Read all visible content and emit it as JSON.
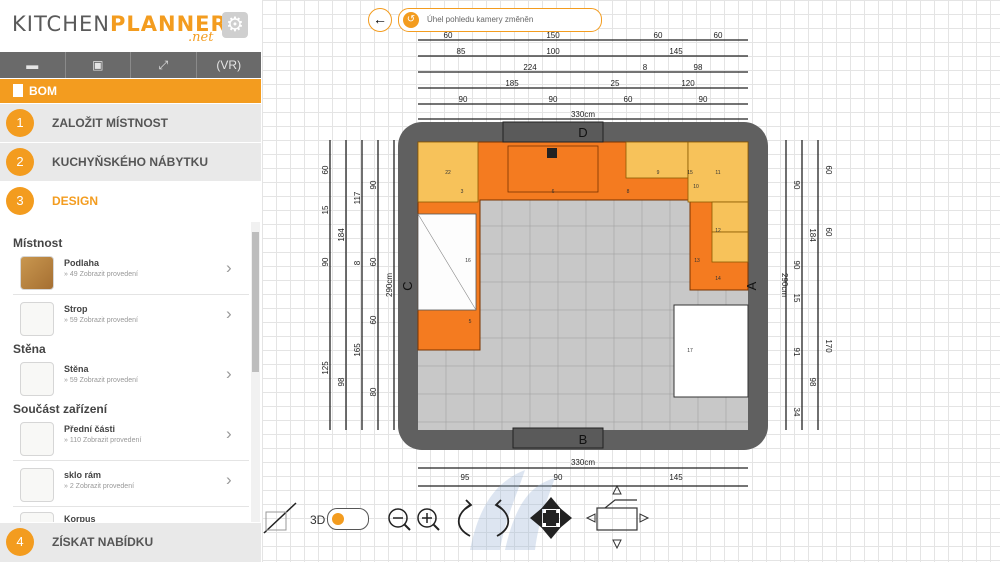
{
  "logo": {
    "brand_part1": "KITCHEN",
    "brand_part2": "PLANNER",
    "sub": ".net"
  },
  "toolbar": {
    "icons": [
      "folder-icon",
      "save-icon",
      "fullscreen-icon",
      "vr-icon"
    ],
    "vr_label": "VR"
  },
  "bom": {
    "label": "BOM"
  },
  "steps": [
    {
      "num": "1",
      "label": "ZALOŽIT MÍSTNOST"
    },
    {
      "num": "2",
      "label": "KUCHYŇSKÉHO NÁBYTKU"
    },
    {
      "num": "3",
      "label": "DESIGN"
    },
    {
      "num": "4",
      "label": "ZÍSKAT NABÍDKU"
    }
  ],
  "sections": {
    "room": "Místnost",
    "wall": "Stěna",
    "equipment": "Součást zařízení"
  },
  "items": [
    {
      "title": "Podlaha",
      "sub": "» 49 Zobrazit provedení"
    },
    {
      "title": "Strop",
      "sub": "» 59 Zobrazit provedení"
    },
    {
      "title": "Stěna",
      "sub": "» 59 Zobrazit provedení"
    },
    {
      "title": "Přední části",
      "sub": "» 110 Zobrazit provedení"
    },
    {
      "title": "sklo rám",
      "sub": "» 2 Zobrazit provedení"
    },
    {
      "title": "Korpus",
      "sub": ""
    }
  ],
  "status": {
    "message": "Úhel pohledu kamery změněn"
  },
  "toggle": {
    "label": "3D"
  },
  "plan": {
    "top_dims": [
      [
        "60",
        "150",
        "60",
        "60"
      ],
      [
        "85",
        "100",
        "145"
      ],
      [
        "224",
        "8",
        "98"
      ],
      [
        "185",
        "25",
        "120"
      ],
      [
        "90",
        "90",
        "60",
        "90"
      ]
    ],
    "total_top": "330cm",
    "total_bottom": "330cm",
    "bottom_dims": [
      "95",
      "90",
      "145"
    ],
    "left_dims": [
      "60",
      "15",
      "184",
      "117",
      "90",
      "8",
      "60",
      "90",
      "60",
      "125",
      "165",
      "98",
      "80"
    ],
    "right_dims": [
      "60",
      "90",
      "184",
      "60",
      "90",
      "15",
      "91",
      "170",
      "98",
      "34"
    ],
    "height_label": "290cm",
    "walls": {
      "top": "D",
      "bottom": "B",
      "left": "C",
      "right": "A"
    },
    "cabinet_numbers": [
      "22",
      "3",
      "6",
      "8",
      "9",
      "15",
      "10",
      "11",
      "12",
      "13",
      "14",
      "16",
      "5",
      "17"
    ]
  },
  "colors": {
    "accent": "#f39c1f",
    "cabinet_orange": "#f47b20",
    "cabinet_light": "#f7c25a",
    "wall": "#606060",
    "floor": "#bebebe"
  }
}
